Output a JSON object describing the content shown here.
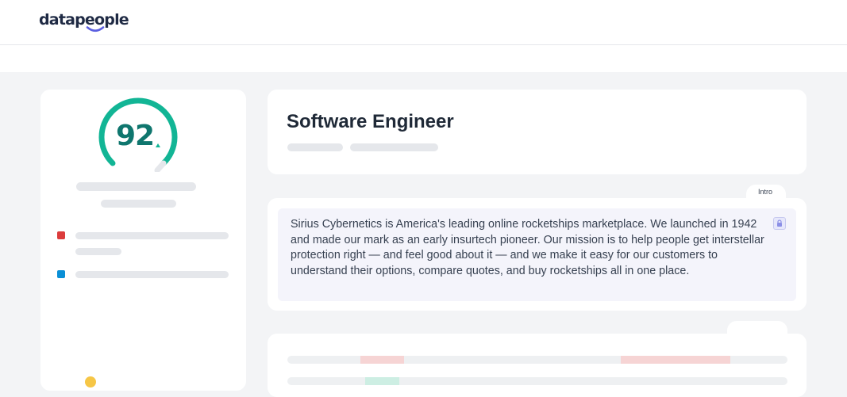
{
  "header": {
    "logo_text": "datapeople",
    "logo_icon": "smile-logo-icon"
  },
  "score_panel": {
    "score": "92",
    "gauge_value_percent": 92,
    "gauge_color": "#12b595",
    "alert_color": "#dc3c3c",
    "info_color": "#0a8fd6"
  },
  "job": {
    "title": "Software Engineer"
  },
  "intro": {
    "tab_label": "Intro",
    "text": "Sirius Cybernetics is America's leading online rocketships marketplace. We launched in 1942 and made our mark as an early insurtech pioneer. Our mission is to help people get interstellar protection right — and feel good about it — and we make it easy for our customers to understand their options, compare quotes, and buy rocketships all in one place.",
    "lock_icon": "lock-icon"
  }
}
